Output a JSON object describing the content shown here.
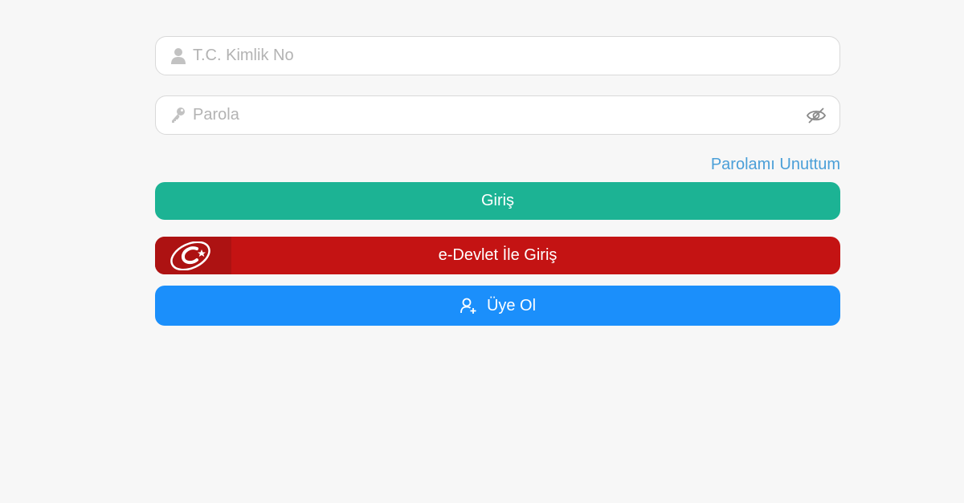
{
  "login_form": {
    "tc_field": {
      "placeholder": "T.C. Kimlik No",
      "icon": "user-icon"
    },
    "password_field": {
      "placeholder": "Parola",
      "icon": "key-icon",
      "toggle_icon": "eye-slash-icon"
    },
    "forgot_password_label": "Parolamı Unuttum",
    "login_button_label": "Giriş",
    "edevlet_button_label": "e-Devlet İle Giriş",
    "register_button_label": "Üye Ol"
  },
  "colors": {
    "background": "#f7f7f7",
    "login_button": "#1cb394",
    "edevlet_button": "#c41313",
    "register_button": "#1b8ffb",
    "link": "#4a9fd8"
  }
}
